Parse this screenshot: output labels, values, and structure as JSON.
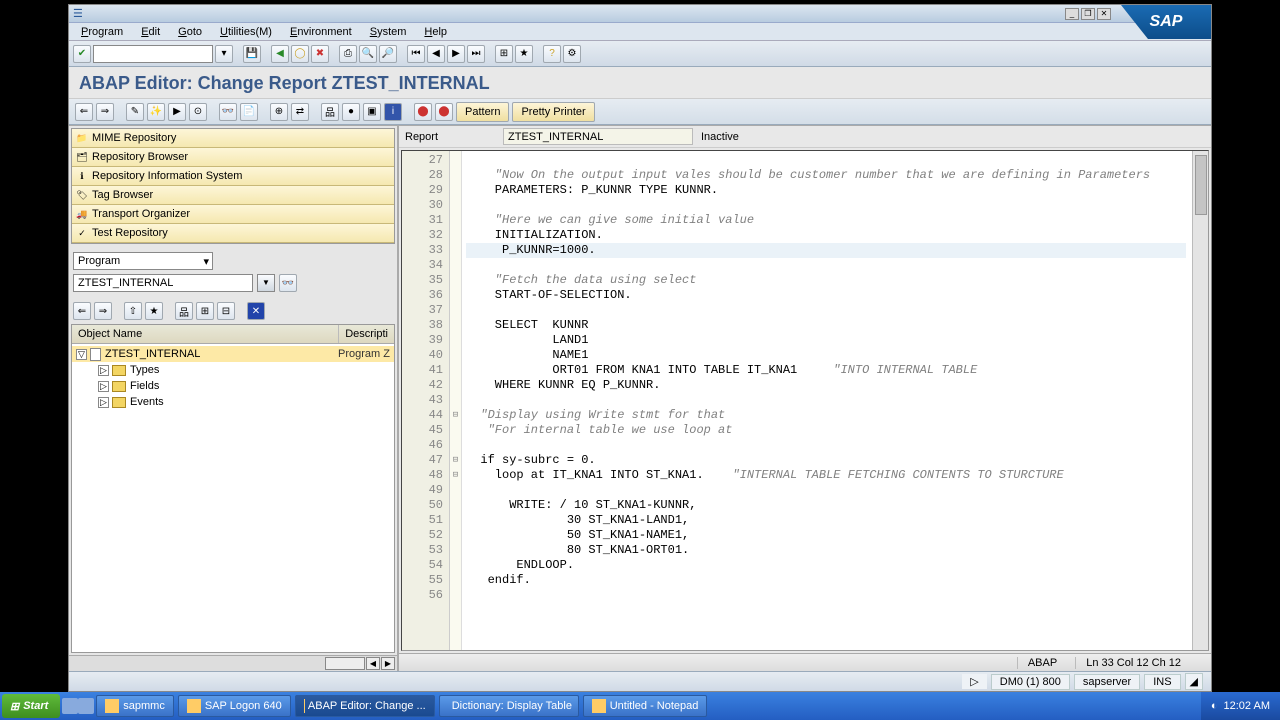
{
  "menubar": [
    "Program",
    "Edit",
    "Goto",
    "Utilities(M)",
    "Environment",
    "System",
    "Help"
  ],
  "page_title": "ABAP Editor: Change Report ZTEST_INTERNAL",
  "app_buttons": {
    "pattern": "Pattern",
    "pretty": "Pretty Printer"
  },
  "nav": {
    "items": [
      "MIME Repository",
      "Repository Browser",
      "Repository Information System",
      "Tag Browser",
      "Transport Organizer",
      "Test Repository"
    ],
    "obj_type": "Program",
    "obj_name": "ZTEST_INTERNAL"
  },
  "tree": {
    "col1": "Object Name",
    "col2": "Descripti",
    "root": "ZTEST_INTERNAL",
    "root_desc": "Program Z",
    "children": [
      "Types",
      "Fields",
      "Events"
    ]
  },
  "report": {
    "label": "Report",
    "name": "ZTEST_INTERNAL",
    "status": "Inactive"
  },
  "code": {
    "start": 27,
    "lines": [
      {
        "t": ""
      },
      {
        "t": "    \"Now On the output input vales should be customer number that we are defining in Parameters",
        "c": true
      },
      {
        "t": "    PARAMETERS: P_KUNNR TYPE KUNNR."
      },
      {
        "t": ""
      },
      {
        "t": "    \"Here we can give some initial value",
        "c": true
      },
      {
        "t": "    INITIALIZATION."
      },
      {
        "t": "     P_KUNNR=1000.",
        "hl": true
      },
      {
        "t": ""
      },
      {
        "t": "    \"Fetch the data using select",
        "c": true
      },
      {
        "t": "    START-OF-SELECTION."
      },
      {
        "t": ""
      },
      {
        "t": "    SELECT  KUNNR"
      },
      {
        "t": "            LAND1"
      },
      {
        "t": "            NAME1"
      },
      {
        "t": "            ORT01 FROM KNA1 INTO TABLE IT_KNA1     \"INTO INTERNAL TABLE",
        "mix": true
      },
      {
        "t": "    WHERE KUNNR EQ P_KUNNR."
      },
      {
        "t": ""
      },
      {
        "t": "  \"Display using Write stmt for that",
        "c": true,
        "fold": "⊟"
      },
      {
        "t": "   \"For internal table we use loop at",
        "c": true
      },
      {
        "t": ""
      },
      {
        "t": "  if sy-subrc = 0.",
        "fold": "⊟"
      },
      {
        "t": "    loop at IT_KNA1 INTO ST_KNA1.    \"INTERNAL TABLE FETCHING CONTENTS TO STURCTURE",
        "mix": true,
        "fold": "⊟"
      },
      {
        "t": ""
      },
      {
        "t": "      WRITE: / 10 ST_KNA1-KUNNR,"
      },
      {
        "t": "              30 ST_KNA1-LAND1,"
      },
      {
        "t": "              50 ST_KNA1-NAME1,"
      },
      {
        "t": "              80 ST_KNA1-ORT01."
      },
      {
        "t": "       ENDLOOP."
      },
      {
        "t": "   endif."
      },
      {
        "t": ""
      }
    ]
  },
  "editor_status": {
    "lang": "ABAP",
    "pos": "Ln 33 Col 12 Ch 12"
  },
  "bottom_status": {
    "sys": "DM0 (1) 800",
    "server": "sapserver",
    "mode": "INS"
  },
  "taskbar": {
    "start": "Start",
    "items": [
      "sapmmc",
      "SAP Logon 640",
      "ABAP Editor: Change ...",
      "Dictionary: Display Table",
      "Untitled - Notepad"
    ],
    "active": 2,
    "clock": "12:02 AM"
  },
  "sap_logo": "SAP"
}
